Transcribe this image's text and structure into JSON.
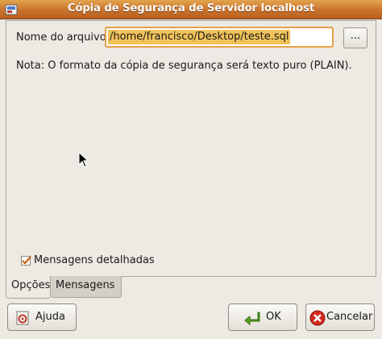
{
  "window": {
    "title": "Cópia de Segurança de Servidor localhost"
  },
  "options": {
    "file_label": "Nome do arquivo",
    "file_value": "/home/francisco/Desktop/teste.sql",
    "browse_label": "...",
    "note": "Nota: O formato da cópia de segurança será texto puro (PLAIN).",
    "verbose_label": "Mensagens detalhadas",
    "verbose_checked": true
  },
  "tabs": [
    {
      "label": "Opções",
      "active": true
    },
    {
      "label": "Mensagens",
      "active": false
    }
  ],
  "buttons": {
    "help": "Ajuda",
    "ok": "OK",
    "cancel": "Cancelar"
  }
}
